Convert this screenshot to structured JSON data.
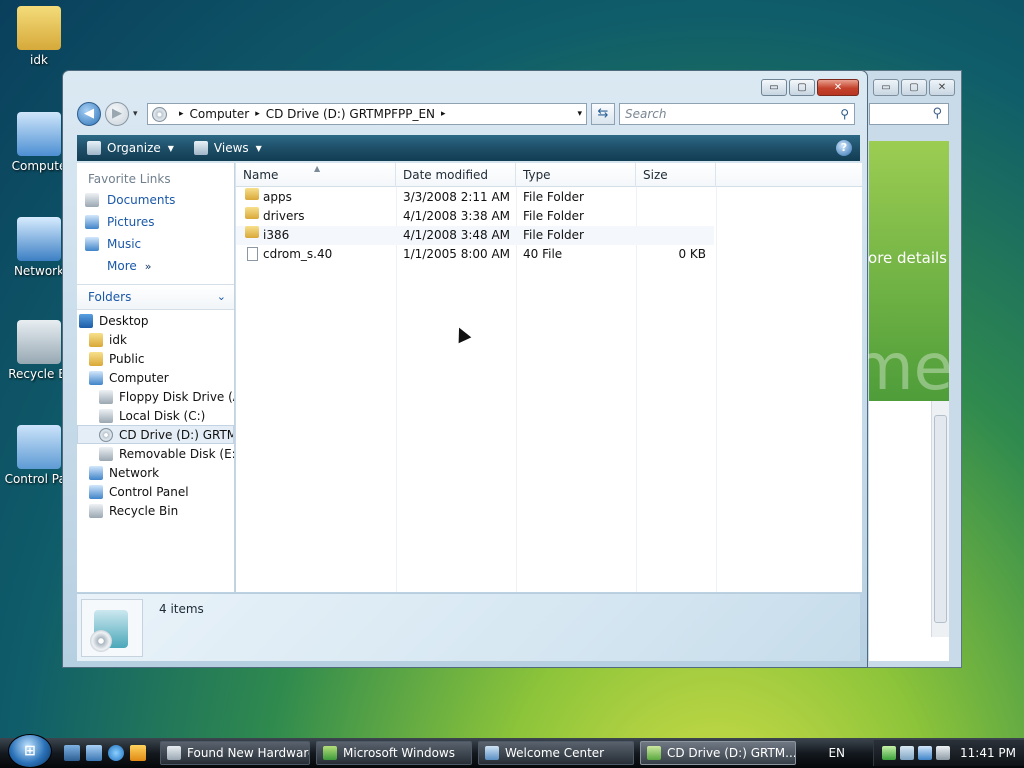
{
  "desktop": {
    "icons": [
      {
        "label": "idk",
        "icon": "folder-icon"
      },
      {
        "label": "Compute",
        "icon": "computer-icon"
      },
      {
        "label": "Network",
        "icon": "network-icon"
      },
      {
        "label": "Recycle Bi",
        "icon": "recycle-bin-icon"
      },
      {
        "label": "Control Pan",
        "icon": "control-panel-icon"
      }
    ]
  },
  "background_window": {
    "ctrl_min": "▭",
    "ctrl_max": "▢",
    "ctrl_close": "✕",
    "search_icon": "⚲",
    "more_details_text": "ore details",
    "banner_text": "me"
  },
  "window": {
    "ctrl_min": "▭",
    "ctrl_max": "▢",
    "ctrl_close": "✕",
    "nav": {
      "back": "◀",
      "forward": "▶",
      "dropdown": "▾"
    },
    "address": {
      "path": [
        "Computer",
        "CD Drive (D:) GRTMPFPP_EN"
      ],
      "separator": "▸",
      "dropdown": "▾"
    },
    "refresh": "⇆",
    "search": {
      "placeholder": "Search",
      "icon": "⚲"
    },
    "toolbar": {
      "organize": "Organize",
      "views": "Views",
      "dropdown": "▼",
      "help": "?"
    },
    "favorite_links": {
      "header": "Favorite Links",
      "items": [
        "Documents",
        "Pictures",
        "Music"
      ],
      "more": "More",
      "more_chevron": "»"
    },
    "folders": {
      "header": "Folders",
      "chevron": "⌄",
      "tree": [
        {
          "label": "Desktop",
          "indent": 0
        },
        {
          "label": "idk",
          "indent": 1
        },
        {
          "label": "Public",
          "indent": 1
        },
        {
          "label": "Computer",
          "indent": 1
        },
        {
          "label": "Floppy Disk Drive (A:)",
          "indent": 2
        },
        {
          "label": "Local Disk (C:)",
          "indent": 2
        },
        {
          "label": "CD Drive (D:) GRTMPF",
          "indent": 2,
          "selected": true
        },
        {
          "label": "Removable Disk (E:)",
          "indent": 2
        },
        {
          "label": "Network",
          "indent": 1
        },
        {
          "label": "Control Panel",
          "indent": 1
        },
        {
          "label": "Recycle Bin",
          "indent": 1
        }
      ]
    },
    "columns": [
      "Name",
      "Date modified",
      "Type",
      "Size"
    ],
    "sort_arrow": "▲",
    "files": [
      {
        "name": "apps",
        "date": "3/3/2008 2:11 AM",
        "type": "File Folder",
        "size": "",
        "kind": "folder"
      },
      {
        "name": "drivers",
        "date": "4/1/2008 3:38 AM",
        "type": "File Folder",
        "size": "",
        "kind": "folder"
      },
      {
        "name": "i386",
        "date": "4/1/2008 3:48 AM",
        "type": "File Folder",
        "size": "",
        "kind": "folder"
      },
      {
        "name": "cdrom_s.40",
        "date": "1/1/2005 8:00 AM",
        "type": "40 File",
        "size": "0 KB",
        "kind": "file"
      }
    ],
    "details": {
      "count": "4 items"
    }
  },
  "taskbar": {
    "start": "⊞",
    "tasks": [
      {
        "label": "Found New Hardware",
        "active": false
      },
      {
        "label": "Microsoft Windows",
        "active": false
      },
      {
        "label": "Welcome Center",
        "active": false
      },
      {
        "label": "CD Drive (D:) GRTM...",
        "active": true
      }
    ],
    "language": "EN",
    "time": "11:41 PM"
  }
}
